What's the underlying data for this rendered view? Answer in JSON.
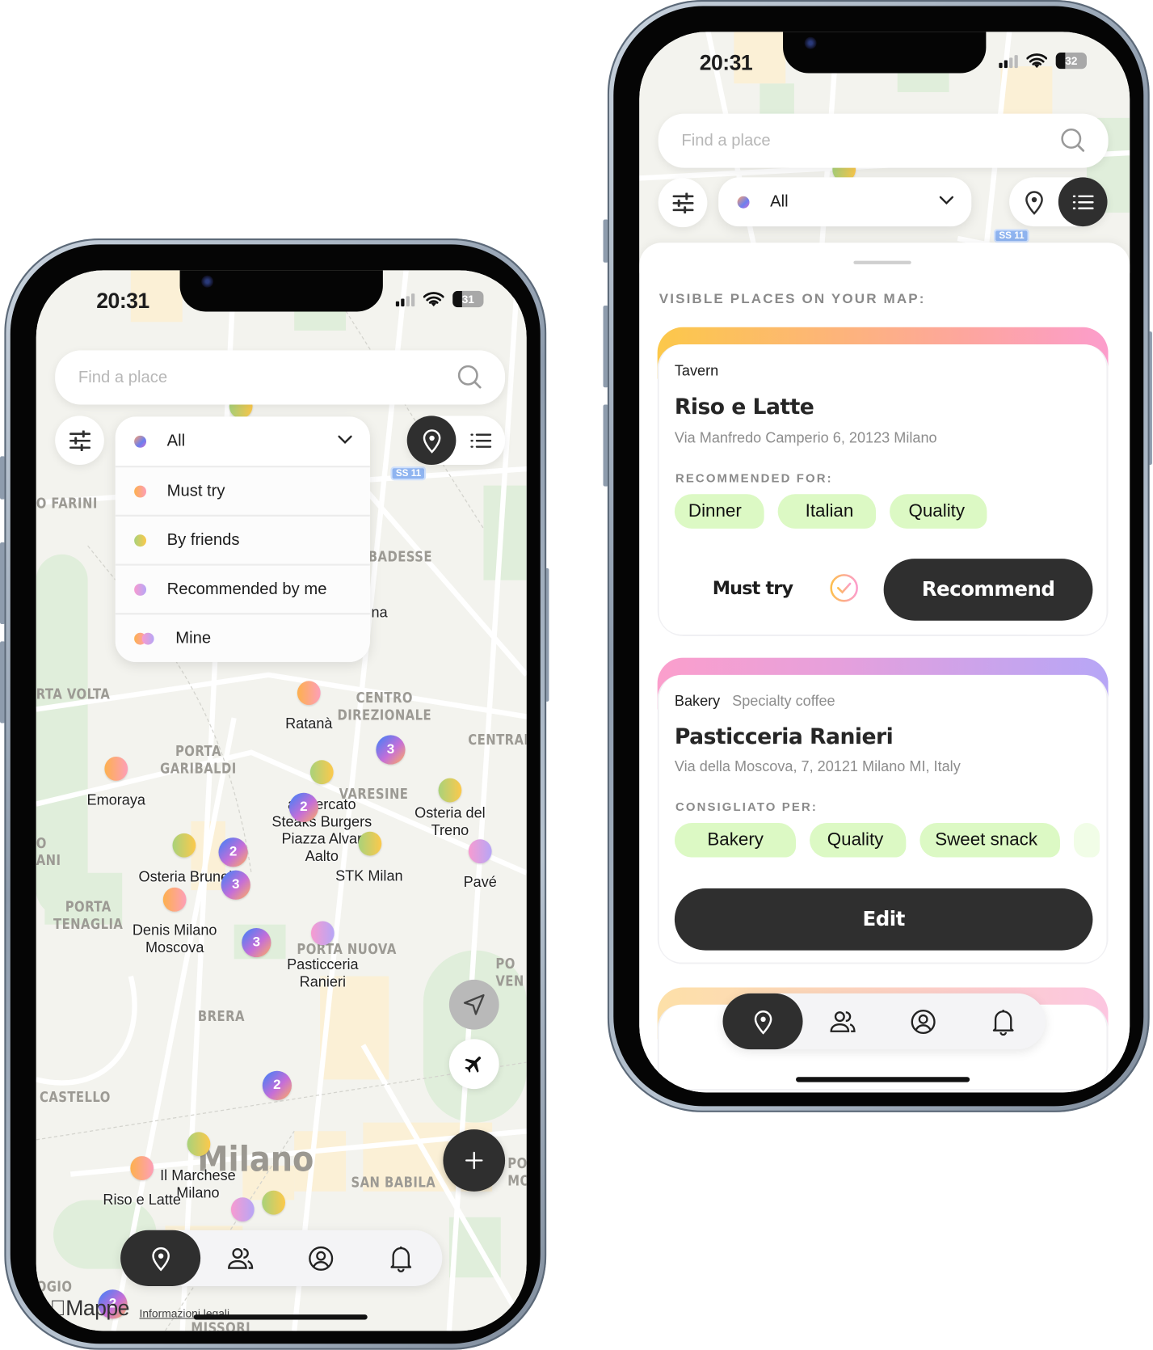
{
  "colors": {
    "accent_dark": "#2f2f2f",
    "chip_bg": "#dcf9c4",
    "must_try": [
      "#fdb04e",
      "#fd9fb8"
    ],
    "by_friends": [
      "#a9d27a",
      "#fcc94c"
    ],
    "recommended_by_me": [
      "#f79bd0",
      "#b7a6f6"
    ]
  },
  "left": {
    "status": {
      "time": "20:31",
      "battery": "31"
    },
    "search": {
      "placeholder": "Find a place"
    },
    "filter": {
      "options": [
        {
          "label": "All",
          "dot": "all"
        },
        {
          "label": "Must try",
          "dot": "must-try"
        },
        {
          "label": "By friends",
          "dot": "by-friends"
        },
        {
          "label": "Recommended by me",
          "dot": "recommended-by-me"
        },
        {
          "label": "Mine",
          "dot": "mine"
        }
      ],
      "expanded": true,
      "selected": "All"
    },
    "view_mode": "map",
    "map": {
      "places": [
        "Ratanà",
        "Emoraya",
        "al Mercato\nSteaks Burgers",
        "Osteria del Treno",
        "Piazza Alvar\nAalto",
        "Osteria Brunella",
        "STK Milan",
        "Pavé",
        "Denis Milano\nMoscova",
        "Pasticceria\nRanieri",
        "Il Marchese\nMilano",
        "Riso e Latte"
      ],
      "districts": [
        "O FARINI",
        "BADESSE",
        "RTA VOLTA",
        "CENTRO\nDIREZIONALE",
        "CENTRAL",
        "PORTA\nGARIBALDI",
        "VARESINE",
        "O\nANI",
        "PORTA\nTENAGLIA",
        "PORTA NUOVA",
        "BRERA",
        "CASTELLO",
        "PO\nVEN",
        "SAN BABILA",
        "PO\nMON",
        "OGIO",
        "MISSORI",
        "na",
        "SS 11"
      ],
      "city": "Milano",
      "cluster_counts": [
        "3",
        "2",
        "2",
        "3",
        "3",
        "2",
        "2"
      ],
      "attribution": "Mappe",
      "legal": "Informazioni legali"
    },
    "tabs": [
      "map",
      "friends",
      "profile",
      "notifications"
    ],
    "active_tab": "map"
  },
  "right": {
    "status": {
      "time": "20:31",
      "battery": "32"
    },
    "search": {
      "placeholder": "Find a place"
    },
    "filter": {
      "selected": "All"
    },
    "view_mode": "list",
    "map": {
      "districts": [
        "SS 11"
      ]
    },
    "list_title": "VISIBLE PLACES ON YOUR MAP:",
    "cards": [
      {
        "categories": [
          "Tavern"
        ],
        "name": "Riso e Latte",
        "address": "Via Manfredo Camperio 6, 20123 Milano",
        "recommended_label": "RECOMMENDED FOR:",
        "tags": [
          "Dinner",
          "Italian",
          "Quality"
        ],
        "must_try_label": "Must try",
        "must_try_checked": true,
        "action": "Recommend"
      },
      {
        "categories": [
          "Bakery",
          "Specialty coffee"
        ],
        "name": "Pasticceria Ranieri",
        "address": "Via della Moscova, 7, 20121 Milano MI, Italy",
        "recommended_label": "CONSIGLIATO PER:",
        "tags": [
          "Bakery",
          "Quality",
          "Sweet snack"
        ],
        "action": "Edit"
      }
    ],
    "tabs": [
      "map",
      "friends",
      "profile",
      "notifications"
    ],
    "active_tab": "map"
  }
}
